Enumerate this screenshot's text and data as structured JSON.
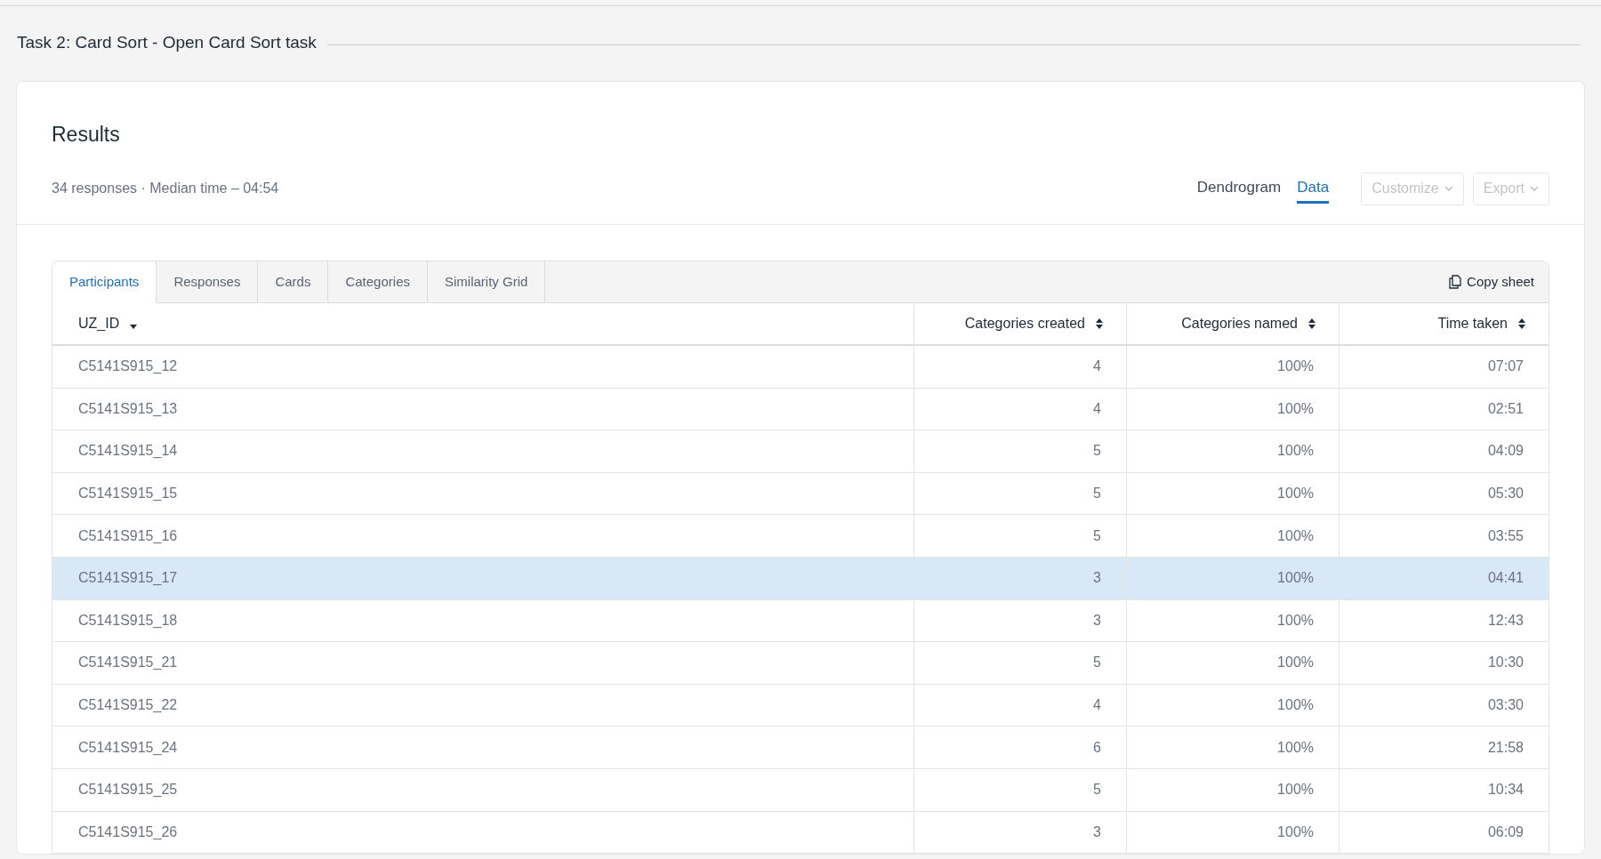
{
  "section_title": "Task 2: Card Sort - Open Card Sort task",
  "results": {
    "title": "Results",
    "summary": "34 responses · Median time – 04:54",
    "views": [
      {
        "label": "Dendrogram",
        "selected": false
      },
      {
        "label": "Data",
        "selected": true
      }
    ],
    "menus": [
      {
        "label": "Customize",
        "disabled": true
      },
      {
        "label": "Export",
        "disabled": true
      }
    ]
  },
  "data_tabs": [
    {
      "label": "Participants",
      "selected": true
    },
    {
      "label": "Responses",
      "selected": false
    },
    {
      "label": "Cards",
      "selected": false
    },
    {
      "label": "Categories",
      "selected": false
    },
    {
      "label": "Similarity Grid",
      "selected": false
    }
  ],
  "copy_button": "Copy sheet",
  "table": {
    "columns": [
      {
        "label": "UZ_ID",
        "sorted": true
      },
      {
        "label": "Categories created",
        "sorted": false
      },
      {
        "label": "Categories named",
        "sorted": false
      },
      {
        "label": "Time taken",
        "sorted": false
      }
    ],
    "rows": [
      {
        "cells": [
          "C5141S915_12",
          "4",
          "100%",
          "07:07"
        ],
        "selected": false
      },
      {
        "cells": [
          "C5141S915_13",
          "4",
          "100%",
          "02:51"
        ],
        "selected": false
      },
      {
        "cells": [
          "C5141S915_14",
          "5",
          "100%",
          "04:09"
        ],
        "selected": false
      },
      {
        "cells": [
          "C5141S915_15",
          "5",
          "100%",
          "05:30"
        ],
        "selected": false
      },
      {
        "cells": [
          "C5141S915_16",
          "5",
          "100%",
          "03:55"
        ],
        "selected": false
      },
      {
        "cells": [
          "C5141S915_17",
          "3",
          "100%",
          "04:41"
        ],
        "selected": true
      },
      {
        "cells": [
          "C5141S915_18",
          "3",
          "100%",
          "12:43"
        ],
        "selected": false
      },
      {
        "cells": [
          "C5141S915_21",
          "5",
          "100%",
          "10:30"
        ],
        "selected": false
      },
      {
        "cells": [
          "C5141S915_22",
          "4",
          "100%",
          "03:30"
        ],
        "selected": false
      },
      {
        "cells": [
          "C5141S915_24",
          "6",
          "100%",
          "21:58"
        ],
        "selected": false
      },
      {
        "cells": [
          "C5141S915_25",
          "5",
          "100%",
          "10:34"
        ],
        "selected": false
      },
      {
        "cells": [
          "C5141S915_26",
          "3",
          "100%",
          "06:09"
        ],
        "selected": false
      }
    ]
  }
}
